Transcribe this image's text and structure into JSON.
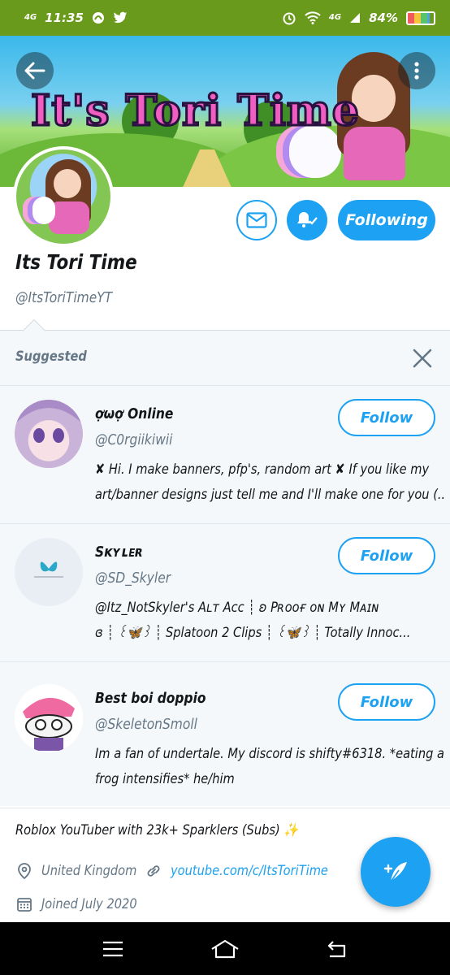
{
  "status_bar": {
    "network_left": "4G",
    "time": "11:35",
    "network_right": "4G",
    "battery": "84%"
  },
  "banner": {
    "title": "It's Tori Time"
  },
  "profile": {
    "display_name": "Its Tori Time",
    "handle": "@ItsToriTimeYT",
    "following_label": "Following",
    "bio": "Roblox YouTuber with 23k+ Sparklers (Subs) ✨",
    "location": "United Kingdom",
    "website": "youtube.com/c/ItsToriTime",
    "joined": "Joined July 2020"
  },
  "suggested": {
    "title": "Suggested",
    "follow_label": "Follow",
    "accounts": [
      {
        "name": "ợωợ Online",
        "handle": "@C0rgiikiwii",
        "bio_lines": [
          "✘ Hi. I make banners, pfp's, random art ✘ If you like my",
          "art/banner designs just tell me and I'll make one for you (..."
        ]
      },
      {
        "name": "Sᴋʏʟᴇʀ",
        "handle": "@SD_Skyler",
        "bio_lines": [
          "@Itz_NotSkyler's Aʟᴛ Aᴄᴄ ┊ ʚ Pʀᴏᴏғ ᴏɴ Mʏ Mᴀɪɴ",
          "ɞ ┊ ꒰🦋꒱ ┊ Splatoon 2 Clips ┊ ꒰🦋꒱ ┊ Totally Innoc..."
        ]
      },
      {
        "name": "Best boi doppio",
        "handle": "@SkeletonSmoll",
        "bio_lines": [
          "Im a fan of undertale. My discord is shifty#6318. *eating a",
          "frog intensifies* he/him"
        ]
      }
    ]
  },
  "colors": {
    "accent": "#1da1f2",
    "status_bar": "#6a9a1c",
    "muted_text": "#657786"
  }
}
